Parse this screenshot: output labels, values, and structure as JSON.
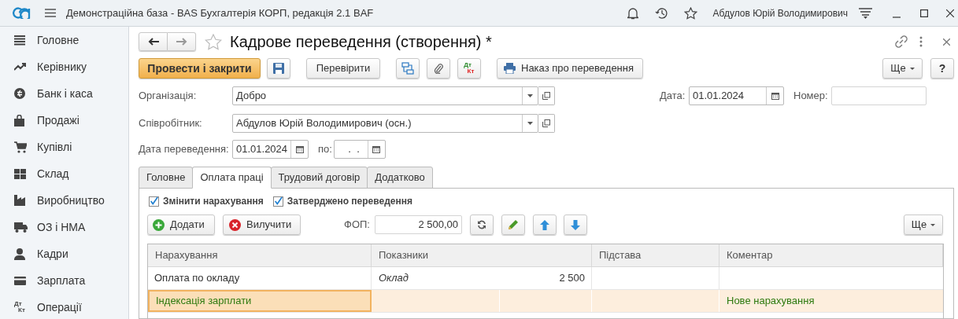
{
  "app": {
    "title": "Демонстраційна база - BAS Бухгалтерія КОРП, редакція 2.1 BAF",
    "user": "Абдулов Юрій Володимирович"
  },
  "sidebar": {
    "items": [
      {
        "label": "Головне"
      },
      {
        "label": "Керівнику"
      },
      {
        "label": "Банк і каса"
      },
      {
        "label": "Продажі"
      },
      {
        "label": "Купівлі"
      },
      {
        "label": "Склад"
      },
      {
        "label": "Виробництво"
      },
      {
        "label": "ОЗ і НМА"
      },
      {
        "label": "Кадри"
      },
      {
        "label": "Зарплата"
      },
      {
        "label": "Операції",
        "icon_text": [
          "Дт",
          "Кт"
        ]
      }
    ]
  },
  "document": {
    "title": "Кадрове переведення (створення) *",
    "toolbar": {
      "primary": "Провести і закрити",
      "check": "Перевірити",
      "dtkt": [
        "Дт",
        "Кт"
      ],
      "print": "Наказ про переведення",
      "more": "Ще",
      "help": "?"
    },
    "organization": {
      "label": "Організація:",
      "value": "Добро"
    },
    "date": {
      "label": "Дата:",
      "value": "01.01.2024"
    },
    "number": {
      "label": "Номер:"
    },
    "employee": {
      "label": "Співробітник:",
      "value": "Абдулов Юрій Володимирович (осн.)"
    },
    "transfer_date": {
      "label": "Дата переведення:",
      "value": "01.01.2024"
    },
    "end_date": {
      "label": "по:",
      "value": "  .  ."
    },
    "tabs": [
      {
        "label": "Головне",
        "selected": false
      },
      {
        "label": "Оплата праці",
        "selected": true
      },
      {
        "label": "Трудовий договір",
        "selected": false
      },
      {
        "label": "Додатково",
        "selected": false
      }
    ],
    "checkboxes": [
      {
        "label": "Змінити нарахування",
        "checked": true
      },
      {
        "label": "Затверджено переведення",
        "checked": true
      }
    ],
    "pay_toolbar": {
      "add": "Додати",
      "remove": "Вилучити",
      "fop_label": "ФОП:",
      "fop_value": "2 500,00",
      "more": "Ще"
    },
    "table": {
      "columns": [
        "Нарахування",
        "Показники",
        "Підстава",
        "Коментар"
      ],
      "rows": [
        {
          "accrual": "Оплата по окладу",
          "indicator": "Оклад",
          "indicator_value": "2 500",
          "comment": "",
          "selected": false,
          "new": false
        },
        {
          "accrual": "Індексація зарплати",
          "indicator": "",
          "indicator_value": "",
          "comment": "Нове нарахування",
          "selected": true,
          "new": true
        }
      ]
    }
  }
}
